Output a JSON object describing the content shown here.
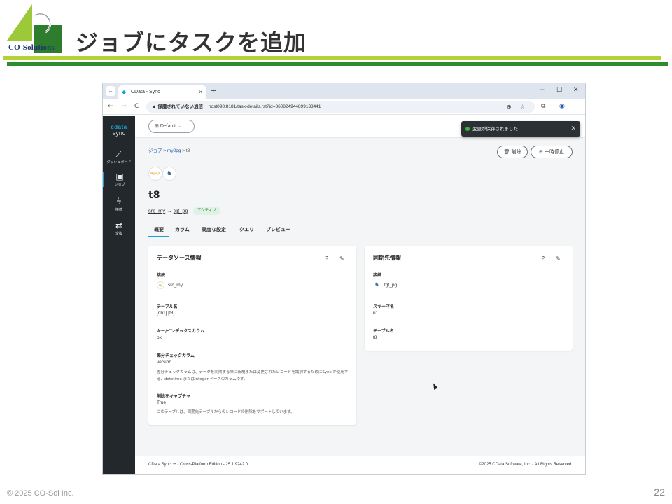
{
  "slide": {
    "title": "ジョブにタスクを追加",
    "logo_text": "CO-Solutions",
    "footer": "© 2025 CO-Sol Inc.",
    "page_number": "22"
  },
  "browser": {
    "tab_title": "CData - Sync",
    "tab_close": "×",
    "new_tab": "+",
    "window_minimize": "−",
    "window_maximize": "☐",
    "window_close": "✕",
    "nav_back": "←",
    "nav_forward": "→",
    "nav_reload": "C",
    "security_warning": "保護されていない通信",
    "url": "host098:8181/task-details.rst?id=860824944899133441"
  },
  "sidebar": {
    "brand_top": "cdata",
    "brand_bottom": "sync",
    "items": [
      {
        "label": "ダッシュボード",
        "icon": "chart-icon"
      },
      {
        "label": "ジョブ",
        "icon": "briefcase-icon"
      },
      {
        "label": "接続",
        "icon": "bolt-icon"
      },
      {
        "label": "変換",
        "icon": "swap-icon"
      }
    ]
  },
  "topbar": {
    "workspace": "Default",
    "toast_message": "変更が保存されました"
  },
  "breadcrumb": {
    "root": "ジョブ",
    "job": "my2pg",
    "task": "t8",
    "separator": ">"
  },
  "actions": {
    "delete": "削除",
    "pause": "一時停止"
  },
  "task": {
    "source_icon_text": "MySQL",
    "name": "t8",
    "source": "src_my",
    "arrow": "→",
    "target": "tgt_pg",
    "status": "アクティブ"
  },
  "tabs": [
    "概要",
    "カラム",
    "高度な設定",
    "クエリ",
    "プレビュー"
  ],
  "source_card": {
    "title": "データソース情報",
    "connection_label": "接続",
    "connection_icon_text": "My",
    "connection_value": "src_my",
    "table_label": "テーブル名",
    "table_value": "[db1].[t8]",
    "key_label": "キー/インデックスカラム",
    "key_value": "pk",
    "diff_label": "差分チェックカラム",
    "diff_value": "version",
    "diff_help": "差分チェックカラムは、データを同期する際に新規または変更されたレコードを識別するためにSync が使用する、datetime またはinteger ベースのカラムです。",
    "delete_label": "削除をキャプチャ",
    "delete_value": "True",
    "delete_help": "このテーブルは、同期先テーブルからのレコードの削除をサポートしています。"
  },
  "target_card": {
    "title": "同期先情報",
    "connection_label": "接続",
    "connection_value": "tgt_pg",
    "schema_label": "スキーマ名",
    "schema_value": "u1",
    "table_label": "テーブル名",
    "table_value": "t8"
  },
  "app_footer": {
    "left": "CData Sync ™ - Cross-Platform Edition - 25.1.9242.0",
    "right": "©2025 CData Software, Inc. - All Rights Reserved."
  },
  "colors": {
    "accent": "#1aa1d8",
    "sidebar": "#23282d",
    "green_bar": "#b3d236",
    "dark_green_bar": "#2e8b2e"
  }
}
